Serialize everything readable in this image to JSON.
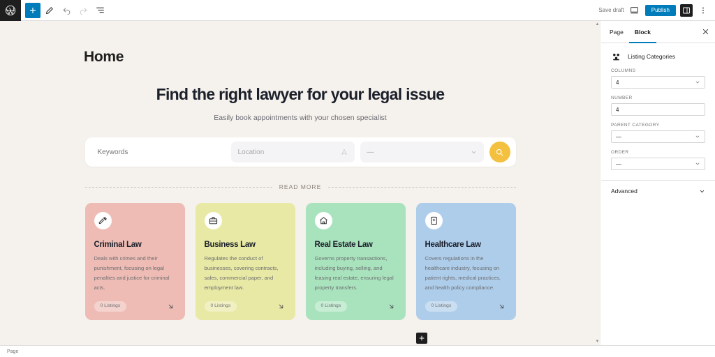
{
  "topbar": {
    "logo_icon": "wordpress-logo-icon",
    "add_block_label": "+",
    "tools": [
      {
        "name": "add-block-button",
        "icon": "plus-icon"
      },
      {
        "name": "tools-button",
        "icon": "pencil-icon"
      },
      {
        "name": "undo-button",
        "icon": "undo-icon"
      },
      {
        "name": "redo-button",
        "icon": "redo-icon"
      },
      {
        "name": "list-view-button",
        "icon": "list-view-icon"
      }
    ],
    "save_draft_label": "Save draft",
    "preview_icon": "desktop-preview-icon",
    "publish_label": "Publish",
    "settings_icon": "settings-sidebar-icon",
    "options_icon": "vertical-ellipsis-icon"
  },
  "sidebar": {
    "tabs": [
      {
        "label": "Page",
        "active": false
      },
      {
        "label": "Block",
        "active": true
      }
    ],
    "close_icon": "close-icon",
    "block": {
      "icon": "listing-categories-icon",
      "name": "Listing Categories"
    },
    "fields": [
      {
        "label": "COLUMNS",
        "value": "4",
        "type": "select"
      },
      {
        "label": "NUMBER",
        "value": "4",
        "type": "text"
      },
      {
        "label": "PARENT CATEGORY",
        "value": "—",
        "type": "select"
      },
      {
        "label": "ORDER",
        "value": "—",
        "type": "select"
      }
    ],
    "advanced_label": "Advanced",
    "advanced_icon": "chevron-down-icon"
  },
  "canvas": {
    "page_title": "Home",
    "hero": {
      "heading": "Find the right lawyer for your legal issue",
      "subheading": "Easily book appointments with your chosen specialist"
    },
    "search": {
      "keywords_placeholder": "Keywords",
      "keywords_value": "",
      "location_placeholder": "Location",
      "location_icon": "location-target-icon",
      "category_value": "—",
      "category_icon": "chevron-down-icon",
      "submit_icon": "search-icon",
      "submit_color": "#f3c13f"
    },
    "read_more_label": "READ MORE",
    "cards": [
      {
        "title": "Criminal Law",
        "description": "Deals with crimes and their punishment, focusing on legal penalties and justice for criminal acts.",
        "listings": "0 Listings",
        "icon": "gavel-icon",
        "bg": "#eebcb4",
        "arrow_icon": "arrow-down-right-icon"
      },
      {
        "title": "Business Law",
        "description": "Regulates the conduct of businesses, covering contracts, sales, commercial paper, and employment law.",
        "listings": "0 Listings",
        "icon": "briefcase-icon",
        "bg": "#e8e9a4",
        "arrow_icon": "arrow-down-right-icon"
      },
      {
        "title": "Real Estate Law",
        "description": "Governs property transactions, including buying, selling, and leasing real estate, ensuring legal property transfers.",
        "listings": "0 Listings",
        "icon": "house-icon",
        "bg": "#a9e3bd",
        "arrow_icon": "arrow-down-right-icon"
      },
      {
        "title": "Healthcare Law",
        "description": "Covers regulations in the healthcare industry, focusing on patient rights, medical practices, and health policy compliance.",
        "listings": "0 Listings",
        "icon": "medical-book-icon",
        "bg": "#aecdea",
        "arrow_icon": "arrow-down-right-icon"
      }
    ],
    "append_block_icon": "plus-icon"
  },
  "footer": {
    "breadcrumb": "Page"
  }
}
